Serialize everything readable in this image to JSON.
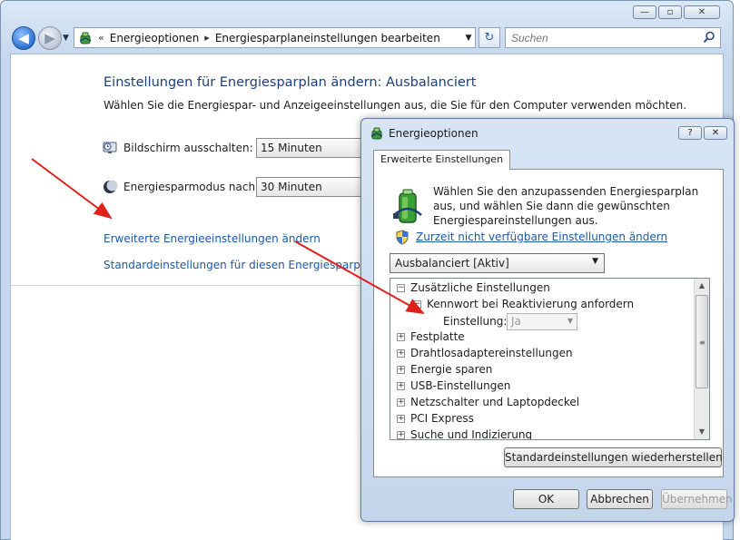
{
  "window": {
    "caption_buttons": {
      "minimize": "—",
      "maximize": "▫",
      "close": "✕"
    },
    "nav": {
      "back_glyph": "◀",
      "forward_glyph": "▶",
      "history_glyph": "▼"
    },
    "breadcrumbs": [
      "Energieoptionen",
      "Energiesparplaneinstellungen bearbeiten"
    ],
    "breadcrumb_lead": "«",
    "breadcrumb_sep": "▸",
    "address_drop": "▼",
    "refresh_glyph": "↻",
    "search_placeholder": "Suchen"
  },
  "main": {
    "title": "Einstellungen für Energiesparplan ändern: Ausbalanciert",
    "subtitle": "Wählen Sie die Energiespar- und Anzeigeeinstellungen aus, die Sie für den Computer verwenden möchten.",
    "display_off": {
      "label": "Bildschirm ausschalten:",
      "value": "15 Minuten"
    },
    "sleep": {
      "label": "Energiesparmodus nach:",
      "value": "30 Minuten"
    },
    "link_advanced": "Erweiterte Energieeinstellungen ändern",
    "link_defaults": "Standardeinstellungen für diesen Energiesparplan wied"
  },
  "dialog": {
    "title": "Energieoptionen",
    "help_glyph": "?",
    "close_glyph": "✕",
    "tab": "Erweiterte Einstellungen",
    "intro": "Wählen Sie den anzupassenden Energiesparplan aus, und wählen Sie dann die gewünschten Energiespareinstellungen aus.",
    "link_unavailable": "Zurzeit nicht verfügbare Einstellungen ändern",
    "plan_select": "Ausbalanciert [Aktiv]",
    "dropdown_glyph": "▼",
    "tree": {
      "items": [
        {
          "label": "Zusätzliche Einstellungen",
          "expander": "−"
        },
        {
          "label": "Kennwort bei Reaktivierung anfordern",
          "expander": "−"
        },
        {
          "label": "Einstellung:",
          "value": "Ja"
        },
        {
          "label": "Festplatte",
          "expander": "+"
        },
        {
          "label": "Drahtlosadaptereinstellungen",
          "expander": "+"
        },
        {
          "label": "Energie sparen",
          "expander": "+"
        },
        {
          "label": "USB-Einstellungen",
          "expander": "+"
        },
        {
          "label": "Netzschalter und Laptopdeckel",
          "expander": "+"
        },
        {
          "label": "PCI Express",
          "expander": "+"
        },
        {
          "label": "Suche und Indizierung",
          "expander": "+"
        }
      ],
      "scroll_up": "▲",
      "scroll_grip": "≡",
      "scroll_down": "▼"
    },
    "restore_button": "Standardeinstellungen wiederherstellen",
    "ok_button": "OK",
    "cancel_button": "Abbrechen",
    "apply_button": "Übernehmen"
  },
  "colors": {
    "link": "#1a5aa8",
    "title": "#1e3f7a",
    "annotation_arrow": "#e0201a"
  }
}
